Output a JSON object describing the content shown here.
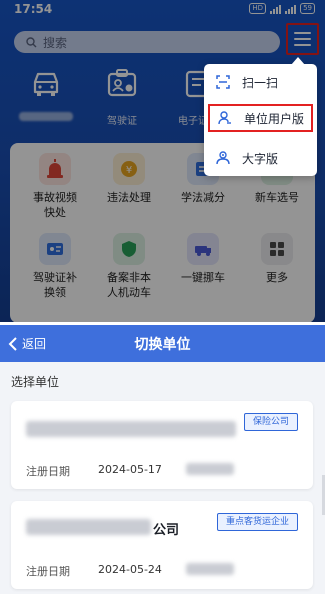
{
  "top": {
    "status": {
      "time": "17:54",
      "battery": "59"
    },
    "search_placeholder": "搜索",
    "features": [
      "驾驶证",
      "电子证件"
    ],
    "grid": [
      {
        "label": "事故视频\n快处",
        "icon": "siren-icon",
        "color": "#e0473a"
      },
      {
        "label": "违法处理",
        "icon": "ticket-icon",
        "color": "#e9a620"
      },
      {
        "label": "学法减分",
        "icon": "book-icon",
        "color": "#2f6fe0"
      },
      {
        "label": "新车选号",
        "icon": "car-plate-icon",
        "color": "#2aa35a"
      },
      {
        "label": "驾驶证补\n换领",
        "icon": "license-icon",
        "color": "#2f6fe0"
      },
      {
        "label": "备案非本\n人机动车",
        "icon": "shield-icon",
        "color": "#2aa35a"
      },
      {
        "label": "一键挪车",
        "icon": "tow-truck-icon",
        "color": "#4a5bd8"
      },
      {
        "label": "更多",
        "icon": "grid-icon",
        "color": "#4a4a4a"
      }
    ],
    "popup": [
      {
        "label": "扫一扫",
        "icon": "scan-icon"
      },
      {
        "label": "单位用户版",
        "icon": "unit-user-icon"
      },
      {
        "label": "大字版",
        "icon": "large-text-icon"
      }
    ]
  },
  "bottom": {
    "back_label": "返回",
    "title": "切换单位",
    "section_title": "选择单位",
    "companies": [
      {
        "tag": "保险公司",
        "name": "",
        "date_label": "注册日期",
        "date": "2024-05-17"
      },
      {
        "tag": "重点客货运企业",
        "name": "公司",
        "date_label": "注册日期",
        "date": "2024-05-24"
      }
    ]
  },
  "colors": {
    "accent": "#3e6fdc",
    "highlight": "#e32121",
    "tag": "#2f66d8"
  }
}
